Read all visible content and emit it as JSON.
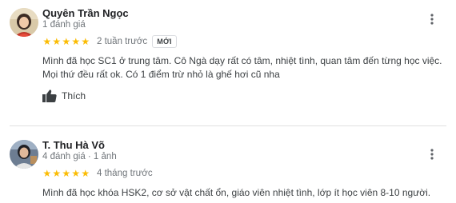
{
  "reviews": [
    {
      "author": "Quyên Trần Ngọc",
      "meta": "1 đánh giá",
      "rating": 5,
      "stars_text": "★★★★★",
      "age": "2 tuần trước",
      "badge": "MỚI",
      "text": "Mình đã học SC1 ở trung tâm. Cô Ngà dạy rất có tâm, nhiệt tình, quan tâm đến từng học việc. Mọi thứ đều rất ok. Có 1 điểm trừ nhỏ là ghế hơi cũ nha",
      "like_label": "Thích",
      "icons": {
        "avatar": "avatar-photo",
        "more": "more-vert-icon",
        "like": "thumbs-up-icon"
      }
    },
    {
      "author": "T. Thu Hà Võ",
      "meta": "4 đánh giá · 1 ảnh",
      "rating": 5,
      "stars_text": "★★★★★",
      "age": "4 tháng trước",
      "text": "Mình đã học khóa HSK2, cơ sở vật chất ổn, giáo viên nhiệt tình, lớp ít học viên 8-10 người.",
      "icons": {
        "avatar": "avatar-photo",
        "more": "more-vert-icon"
      }
    }
  ],
  "colors": {
    "star": "#fbbc04",
    "text_primary": "#202124",
    "text_secondary": "#70757a",
    "divider": "#e0e0e0"
  }
}
